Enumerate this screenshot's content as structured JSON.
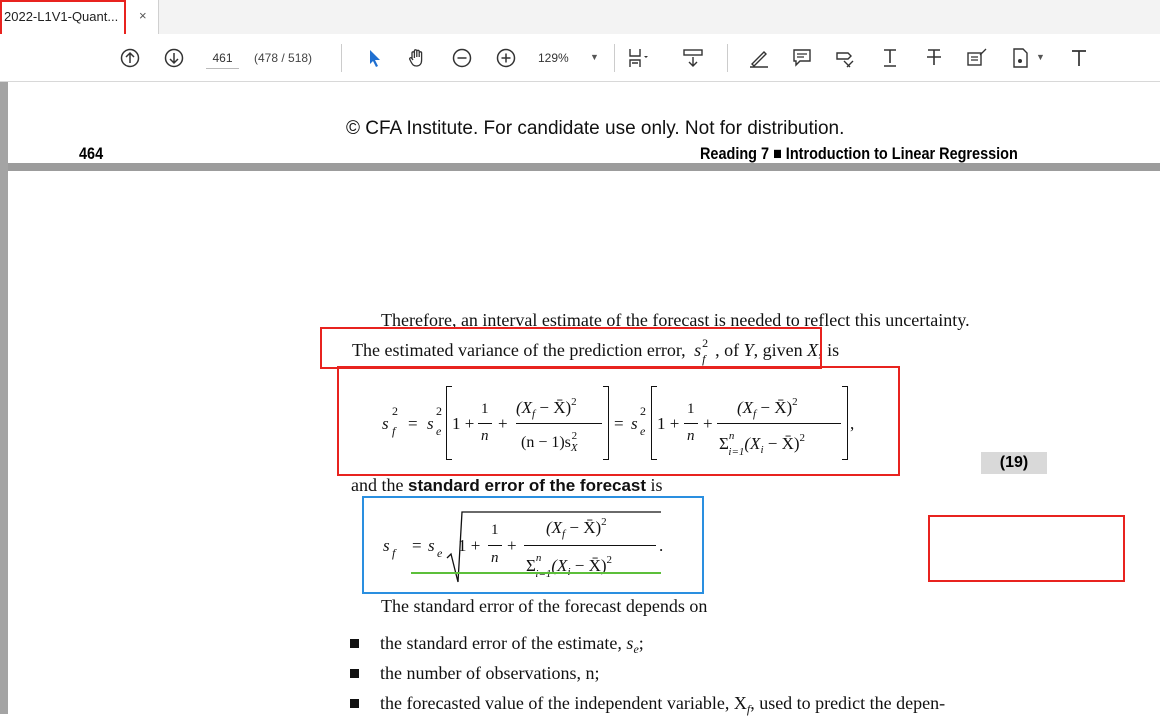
{
  "tab": {
    "title": "2022-L1V1-Quant...",
    "close": "×"
  },
  "toolbar": {
    "page_input": "461",
    "page_count": "(478 / 518)",
    "zoom": "129%"
  },
  "page": {
    "copyright": "© CFA Institute. For candidate use only. Not for distribution.",
    "page_number": "464",
    "running_head": "Reading 7 ■ Introduction to Linear Regression",
    "para1": "Therefore, an interval estimate of the forecast is needed to reflect this uncertainty.",
    "para2_prefix": "The estimated variance of the prediction error,",
    "para2_mid": ", of",
    "para2_suffix": ", given",
    "para2_end": ", is",
    "var_y": "Y",
    "var_x": "X",
    "para3_prefix": "and the",
    "para3_bold": "standard error of the forecast",
    "para3_suffix": "is",
    "equation_number": "(19)",
    "para4": "The standard error of the forecast depends on",
    "bullet1_prefix": "the",
    "bullet1_link": "standard error of the estimate",
    "bullet1_suffix": ", s",
    "bullet1_sub": "e",
    "bullet1_end": ";",
    "bullet2": "the number of observations, n;",
    "bullet3": "the forecasted value of the independent variable, X",
    "bullet3_sub": "f",
    "bullet3_end": ", used to predict the depen-"
  },
  "equation1": {
    "lhs": "s",
    "lhs_sup": "2",
    "lhs_sub": "f",
    "eq": "=",
    "se": "s",
    "se_sup": "2",
    "se_sub": "e",
    "one": "1 +",
    "plus": "+",
    "frac1_num": "1",
    "frac1_den": "n",
    "frac2_num": "(X",
    "frac2_num_sub": "f",
    "frac2_num_rest": " − X̄)",
    "frac2_num_sup": "2",
    "frac2_den": "(n − 1)s",
    "frac2_den_sup": "2",
    "frac2_den_sub": "X",
    "eq2": "=",
    "frac3_den": "Σ",
    "frac3_den_top": "n",
    "frac3_den_bot": "i=1",
    "frac3_den_rest": "(X",
    "frac3_den_sub": "i",
    "frac3_den_tail": " − X̄)",
    "frac3_den_sup": "2",
    "comma": ","
  },
  "equation2": {
    "lhs": "s",
    "lhs_sub": "f",
    "eq": "=",
    "se": "s",
    "se_sub": "e",
    "one": "1 +",
    "plus": "+",
    "period": "."
  }
}
